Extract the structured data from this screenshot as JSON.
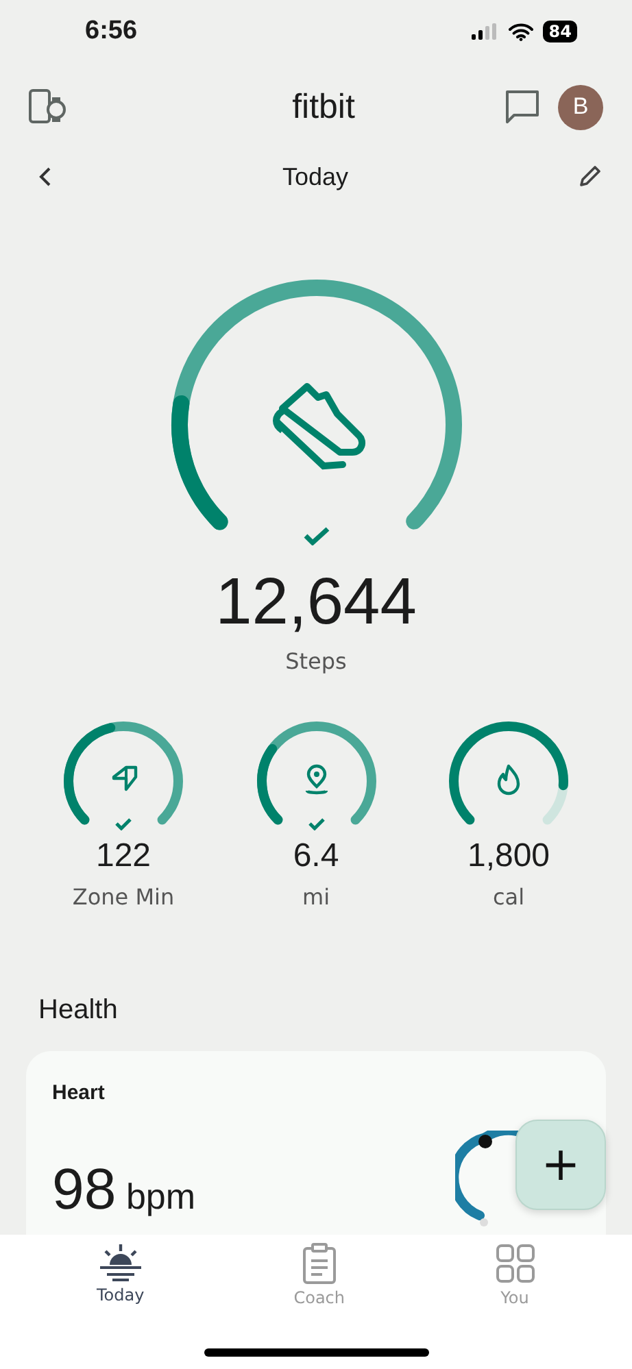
{
  "status_bar": {
    "time": "6:56",
    "battery": "84"
  },
  "header": {
    "title": "fitbit",
    "avatar": "B"
  },
  "date_nav": {
    "title": "Today"
  },
  "steps": {
    "value": "12,644",
    "label": "Steps",
    "goal_met": true
  },
  "stats": [
    {
      "kind": "zone",
      "value": "122",
      "label": "Zone Min",
      "goal_met": true
    },
    {
      "kind": "distance",
      "value": "6.4",
      "label": "mi",
      "goal_met": true
    },
    {
      "kind": "calories",
      "value": "1,800",
      "label": "cal",
      "goal_met": false
    }
  ],
  "section_title": "Health",
  "heart_card": {
    "title": "Heart",
    "value": "98",
    "unit": "bpm"
  },
  "fab": {
    "label": "+"
  },
  "tabs": [
    {
      "kind": "today",
      "label": "Today",
      "selected": true
    },
    {
      "kind": "coach",
      "label": "Coach",
      "selected": false
    },
    {
      "kind": "you",
      "label": "You",
      "selected": false
    }
  ]
}
